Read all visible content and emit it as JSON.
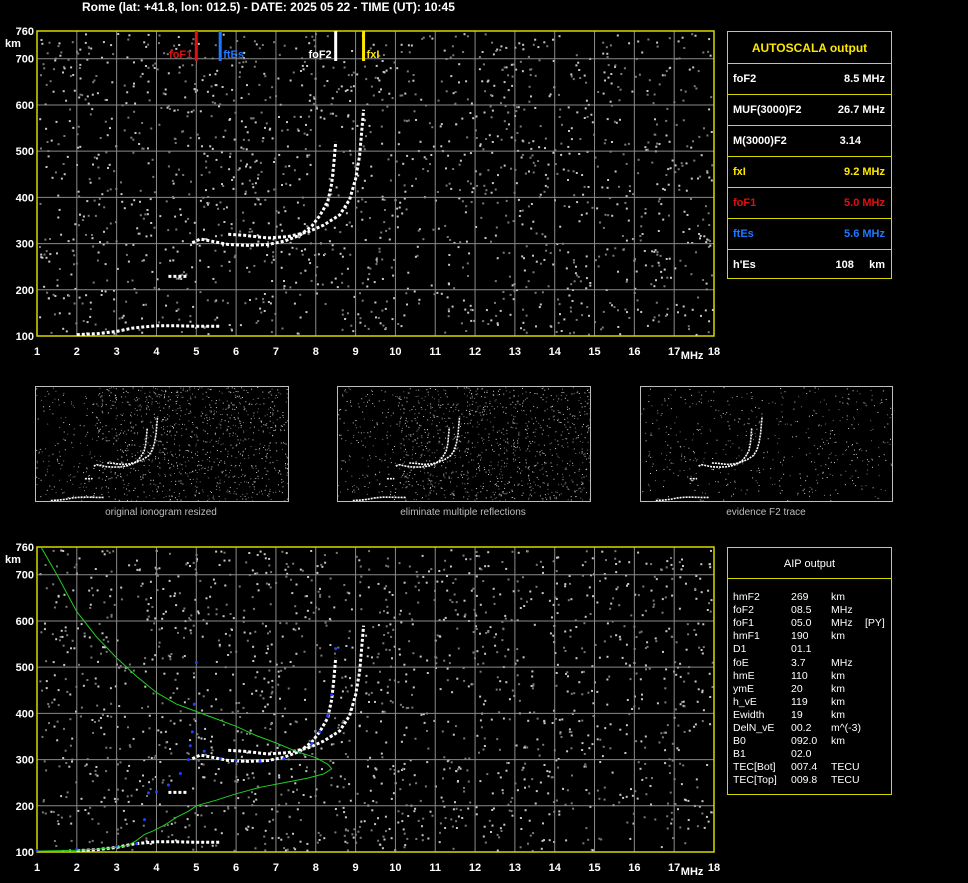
{
  "header": {
    "title": "Rome (lat: +41.8, lon: 012.5) - DATE: 2025 05 22 - TIME (UT): 10:45"
  },
  "colors": {
    "frame": "#d8d800",
    "grid": "#8a8a8a",
    "foF2": "#ffffff",
    "fxI": "#ffe800",
    "foF1": "#e01010",
    "ftEs": "#1e78ff",
    "aip_profile": "#20d020",
    "aip_trace": "#2040ff",
    "thumb_border": "#bdbdbd"
  },
  "chart_data": [
    {
      "type": "scatter",
      "name": "ionogram_autoscala",
      "xlim": [
        1,
        18
      ],
      "ylim": [
        100,
        760
      ],
      "xticks": [
        1,
        2,
        3,
        4,
        5,
        6,
        7,
        8,
        9,
        10,
        11,
        12,
        13,
        14,
        15,
        16,
        17,
        18
      ],
      "yticks": [
        100,
        200,
        300,
        400,
        500,
        600,
        700,
        760
      ],
      "xunit": "MHz",
      "yunit": "km",
      "markers": [
        {
          "label": "foF1",
          "freq": 5.0,
          "color_key": "foF1"
        },
        {
          "label": "ftEs",
          "freq": 5.6,
          "color_key": "ftEs"
        },
        {
          "label": "foF2",
          "freq": 8.5,
          "color_key": "foF2"
        },
        {
          "label": "fxI",
          "freq": 9.2,
          "color_key": "fxI"
        }
      ],
      "traces": [
        {
          "series": "O-mode F trace",
          "points": [
            [
              4.9,
              302
            ],
            [
              5.1,
              310
            ],
            [
              5.4,
              305
            ],
            [
              5.8,
              298
            ],
            [
              6.3,
              296
            ],
            [
              6.8,
              298
            ],
            [
              7.2,
              305
            ],
            [
              7.6,
              318
            ],
            [
              7.9,
              338
            ],
            [
              8.1,
              360
            ],
            [
              8.3,
              390
            ],
            [
              8.4,
              430
            ],
            [
              8.45,
              470
            ],
            [
              8.5,
              520
            ]
          ]
        },
        {
          "series": "X-mode F trace",
          "points": [
            [
              5.8,
              320
            ],
            [
              6.2,
              318
            ],
            [
              6.8,
              312
            ],
            [
              7.3,
              315
            ],
            [
              7.8,
              325
            ],
            [
              8.2,
              340
            ],
            [
              8.6,
              362
            ],
            [
              8.85,
              395
            ],
            [
              9.0,
              440
            ],
            [
              9.1,
              490
            ],
            [
              9.15,
              540
            ],
            [
              9.2,
              590
            ]
          ]
        },
        {
          "series": "Es trace",
          "points": [
            [
              4.3,
              229
            ],
            [
              4.5,
              229
            ],
            [
              4.8,
              229
            ]
          ]
        },
        {
          "series": "E trace",
          "points": [
            [
              2.0,
              103
            ],
            [
              2.5,
              105
            ],
            [
              3.0,
              110
            ],
            [
              3.4,
              117
            ],
            [
              3.6,
              119
            ],
            [
              4.0,
              122
            ],
            [
              4.5,
              122
            ],
            [
              5.0,
              121
            ],
            [
              5.6,
              121
            ]
          ]
        }
      ]
    },
    {
      "type": "scatter",
      "name": "ionogram_aip",
      "xlim": [
        1,
        18
      ],
      "ylim": [
        100,
        760
      ],
      "xticks": [
        1,
        2,
        3,
        4,
        5,
        6,
        7,
        8,
        9,
        10,
        11,
        12,
        13,
        14,
        15,
        16,
        17,
        18
      ],
      "yticks": [
        100,
        200,
        300,
        400,
        500,
        600,
        700,
        760
      ],
      "xunit": "MHz",
      "yunit": "km",
      "traces": [
        {
          "series": "O-mode F trace",
          "points": [
            [
              4.9,
              302
            ],
            [
              5.1,
              310
            ],
            [
              5.4,
              305
            ],
            [
              5.8,
              298
            ],
            [
              6.3,
              296
            ],
            [
              6.8,
              298
            ],
            [
              7.2,
              305
            ],
            [
              7.6,
              318
            ],
            [
              7.9,
              338
            ],
            [
              8.1,
              360
            ],
            [
              8.3,
              390
            ],
            [
              8.4,
              430
            ],
            [
              8.45,
              470
            ],
            [
              8.5,
              520
            ]
          ]
        },
        {
          "series": "X-mode F trace",
          "points": [
            [
              5.8,
              320
            ],
            [
              6.2,
              318
            ],
            [
              6.8,
              312
            ],
            [
              7.3,
              315
            ],
            [
              7.8,
              325
            ],
            [
              8.2,
              340
            ],
            [
              8.6,
              362
            ],
            [
              8.85,
              395
            ],
            [
              9.0,
              440
            ],
            [
              9.1,
              490
            ],
            [
              9.15,
              540
            ],
            [
              9.2,
              590
            ]
          ]
        },
        {
          "series": "Es trace",
          "points": [
            [
              4.3,
              229
            ],
            [
              4.5,
              229
            ],
            [
              4.8,
              229
            ]
          ]
        },
        {
          "series": "E trace",
          "points": [
            [
              2.0,
              103
            ],
            [
              2.5,
              105
            ],
            [
              3.0,
              110
            ],
            [
              3.4,
              117
            ],
            [
              3.6,
              119
            ],
            [
              4.0,
              122
            ],
            [
              4.5,
              122
            ],
            [
              5.0,
              121
            ],
            [
              5.6,
              121
            ]
          ]
        },
        {
          "series": "AIP synthesized trace",
          "color_key": "aip_trace",
          "points": [
            [
              1.0,
              103
            ],
            [
              2.0,
              106
            ],
            [
              3.0,
              112
            ],
            [
              3.5,
              118
            ],
            [
              3.7,
              170
            ],
            [
              3.8,
              228
            ],
            [
              4.0,
              230
            ],
            [
              4.3,
              245
            ],
            [
              4.6,
              270
            ],
            [
              4.8,
              300
            ],
            [
              4.85,
              330
            ],
            [
              4.9,
              360
            ],
            [
              4.95,
              420
            ],
            [
              5.0,
              510
            ],
            [
              5.2,
              318
            ],
            [
              5.6,
              302
            ],
            [
              6.0,
              298
            ],
            [
              6.6,
              296
            ],
            [
              7.2,
              302
            ],
            [
              7.6,
              315
            ],
            [
              7.9,
              335
            ],
            [
              8.1,
              360
            ],
            [
              8.3,
              395
            ],
            [
              8.4,
              440
            ],
            [
              8.5,
              540
            ]
          ]
        },
        {
          "series": "AIP profile",
          "color_key": "aip_profile",
          "points": [
            [
              1.1,
              760
            ],
            [
              1.5,
              700
            ],
            [
              2.0,
              620
            ],
            [
              2.5,
              565
            ],
            [
              3.0,
              520
            ],
            [
              3.5,
              480
            ],
            [
              4.0,
              445
            ],
            [
              4.5,
              420
            ],
            [
              5.0,
              404
            ],
            [
              5.5,
              388
            ],
            [
              6.0,
              372
            ],
            [
              6.5,
              352
            ],
            [
              7.0,
              336
            ],
            [
              7.5,
              318
            ],
            [
              8.0,
              304
            ],
            [
              8.3,
              290
            ],
            [
              8.4,
              280
            ],
            [
              8.2,
              269
            ],
            [
              7.8,
              260
            ],
            [
              7.2,
              250
            ],
            [
              6.6,
              240
            ],
            [
              6.0,
              226
            ],
            [
              5.5,
              212
            ],
            [
              5.0,
              200
            ],
            [
              4.8,
              188
            ],
            [
              4.5,
              175
            ],
            [
              4.2,
              158
            ],
            [
              3.9,
              145
            ],
            [
              3.7,
              138
            ],
            [
              3.5,
              125
            ],
            [
              3.3,
              115
            ],
            [
              3.0,
              110
            ],
            [
              2.5,
              106
            ],
            [
              2.0,
              104
            ],
            [
              1.0,
              102
            ]
          ]
        }
      ]
    }
  ],
  "autoscala": {
    "title": "AUTOSCALA output",
    "rows": [
      {
        "key": "foF2",
        "value": "8.5 MHz",
        "color": "#ffffff"
      },
      {
        "key": "MUF(3000)F2",
        "value": "26.7 MHz",
        "color": "#ffffff"
      },
      {
        "key": "M(3000)F2",
        "value": "3.14",
        "color": "#ffffff"
      },
      {
        "key": "fxI",
        "value": "9.2 MHz",
        "color": "#ffe800"
      },
      {
        "key": "foF1",
        "value": "5.0 MHz",
        "color": "#e01010"
      },
      {
        "key": "ftEs",
        "value": "5.6 MHz",
        "color": "#1e78ff"
      },
      {
        "key": "h'Es",
        "value": "108     km",
        "color": "#ffffff"
      }
    ]
  },
  "aip": {
    "title": "AIP output",
    "rows": [
      {
        "name": "hmF2",
        "value": "269",
        "unit": "km",
        "extra": ""
      },
      {
        "name": "foF2",
        "value": "08.5",
        "unit": "MHz",
        "extra": ""
      },
      {
        "name": "foF1",
        "value": "05.0",
        "unit": "MHz",
        "extra": "[PY]"
      },
      {
        "name": "hmF1",
        "value": "190",
        "unit": "km",
        "extra": ""
      },
      {
        "name": "D1",
        "value": "01.1",
        "unit": "",
        "extra": ""
      },
      {
        "name": "foE",
        "value": "3.7",
        "unit": "MHz",
        "extra": ""
      },
      {
        "name": "hmE",
        "value": "110",
        "unit": "km",
        "extra": ""
      },
      {
        "name": "ymE",
        "value": "20",
        "unit": "km",
        "extra": ""
      },
      {
        "name": "h_vE",
        "value": "119",
        "unit": "km",
        "extra": ""
      },
      {
        "name": "Ewidth",
        "value": "19",
        "unit": "km",
        "extra": ""
      },
      {
        "name": "DelN_vE",
        "value": "00.2",
        "unit": "m^(-3)",
        "extra": ""
      },
      {
        "name": "B0",
        "value": "092.0",
        "unit": "km",
        "extra": ""
      },
      {
        "name": "B1",
        "value": "02.0",
        "unit": "",
        "extra": ""
      },
      {
        "name": "TEC[Bot]",
        "value": "007.4",
        "unit": "TECU",
        "extra": ""
      },
      {
        "name": "TEC[Top]",
        "value": "009.8",
        "unit": "TECU",
        "extra": ""
      }
    ]
  },
  "thumbnails": [
    {
      "caption": "original ionogram resized"
    },
    {
      "caption": "eliminate multiple reflections"
    },
    {
      "caption": "evidence F2 trace"
    }
  ]
}
